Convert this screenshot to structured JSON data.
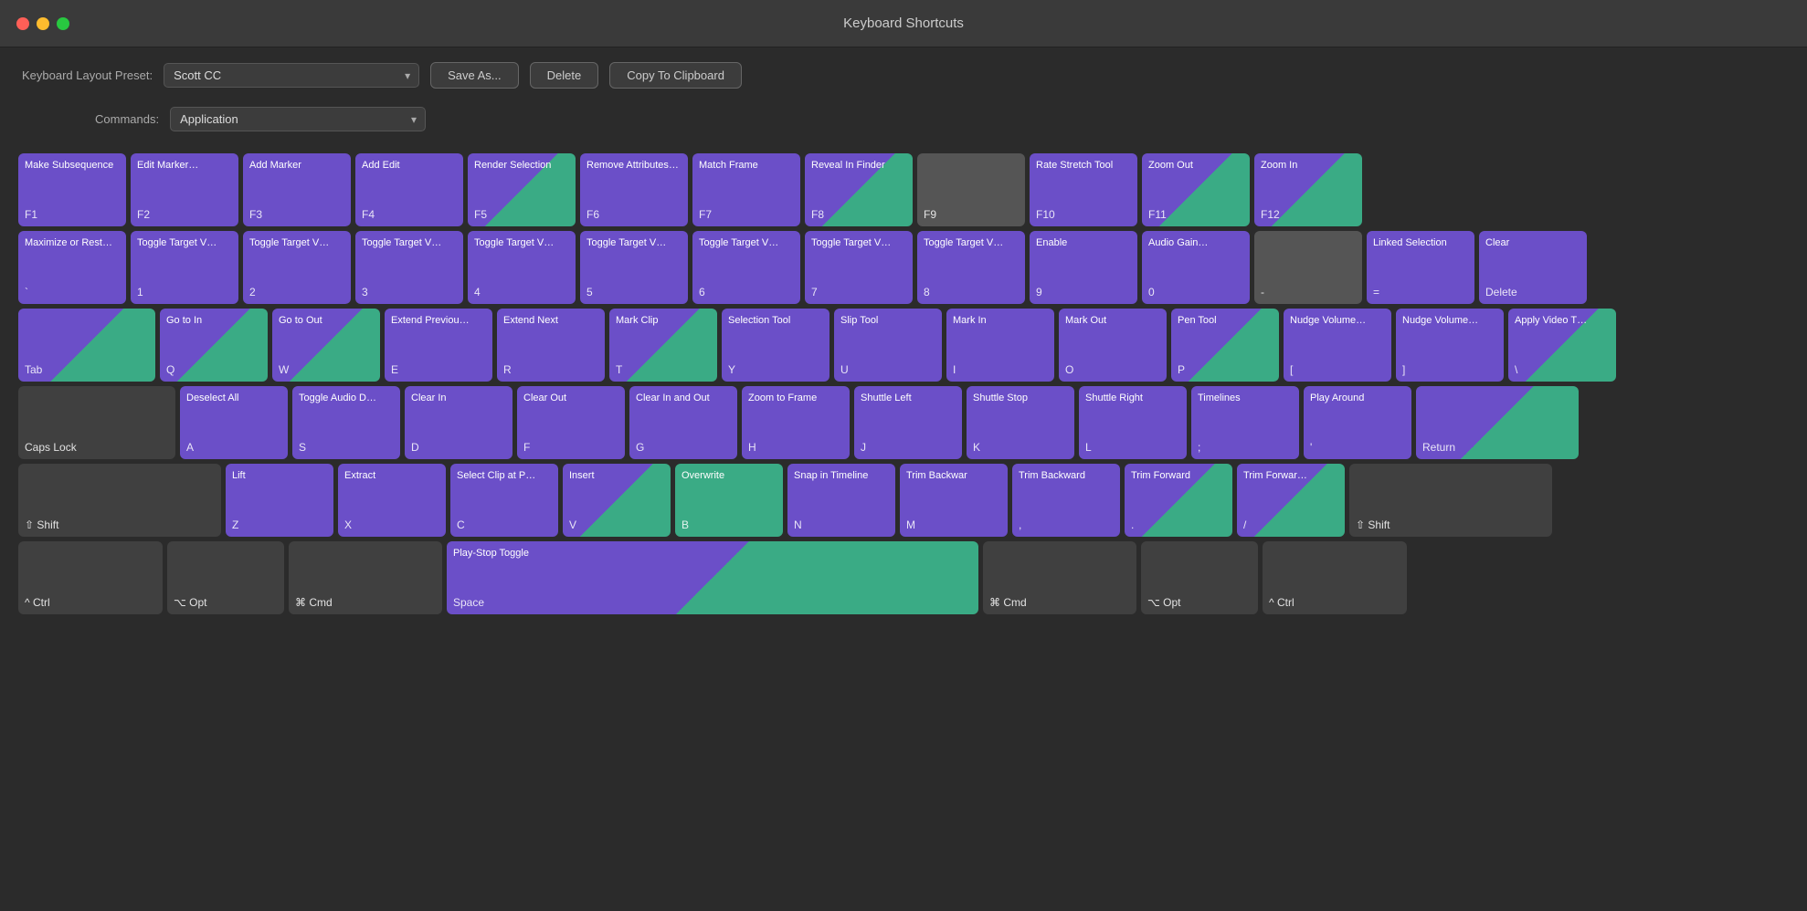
{
  "titleBar": {
    "title": "Keyboard Shortcuts"
  },
  "toolbar": {
    "presetLabel": "Keyboard Layout Preset:",
    "presetValue": "Scott CC",
    "commandsLabel": "Commands:",
    "commandsValue": "Application",
    "saveAsLabel": "Save As...",
    "deleteLabel": "Delete",
    "copyToClipboardLabel": "Copy To Clipboard"
  },
  "rows": [
    {
      "id": "row-fn",
      "keys": [
        {
          "id": "f1",
          "name": "Make Subsequence",
          "shortcut": "F1",
          "style": "purple"
        },
        {
          "id": "f2",
          "name": "Edit Marker…",
          "shortcut": "F2",
          "style": "purple"
        },
        {
          "id": "f3",
          "name": "Add Marker",
          "shortcut": "F3",
          "style": "purple"
        },
        {
          "id": "f4",
          "name": "Add Edit",
          "shortcut": "F4",
          "style": "purple"
        },
        {
          "id": "f5",
          "name": "Render Selection",
          "shortcut": "F5",
          "style": "split"
        },
        {
          "id": "f6",
          "name": "Remove Attributes…",
          "shortcut": "F6",
          "style": "purple"
        },
        {
          "id": "f7",
          "name": "Match Frame",
          "shortcut": "F7",
          "style": "purple"
        },
        {
          "id": "f8",
          "name": "Reveal In Finder",
          "shortcut": "F8",
          "style": "split"
        },
        {
          "id": "f9",
          "name": "",
          "shortcut": "F9",
          "style": "gray"
        },
        {
          "id": "f10",
          "name": "Rate Stretch Tool",
          "shortcut": "F10",
          "style": "purple"
        },
        {
          "id": "f11",
          "name": "Zoom Out",
          "shortcut": "F11",
          "style": "split"
        },
        {
          "id": "f12",
          "name": "Zoom In",
          "shortcut": "F12",
          "style": "split"
        }
      ]
    },
    {
      "id": "row-numbers",
      "keys": [
        {
          "id": "backtick",
          "name": "Maximize or Rest…",
          "shortcut": "`",
          "style": "purple"
        },
        {
          "id": "1",
          "name": "Toggle Target V…",
          "shortcut": "1",
          "style": "purple"
        },
        {
          "id": "2",
          "name": "Toggle Target V…",
          "shortcut": "2",
          "style": "purple"
        },
        {
          "id": "3",
          "name": "Toggle Target V…",
          "shortcut": "3",
          "style": "purple"
        },
        {
          "id": "4",
          "name": "Toggle Target V…",
          "shortcut": "4",
          "style": "purple"
        },
        {
          "id": "5",
          "name": "Toggle Target V…",
          "shortcut": "5",
          "style": "purple"
        },
        {
          "id": "6",
          "name": "Toggle Target V…",
          "shortcut": "6",
          "style": "purple"
        },
        {
          "id": "7",
          "name": "Toggle Target V…",
          "shortcut": "7",
          "style": "purple"
        },
        {
          "id": "8",
          "name": "Toggle Target V…",
          "shortcut": "8",
          "style": "purple"
        },
        {
          "id": "9",
          "name": "Enable",
          "shortcut": "9",
          "style": "purple"
        },
        {
          "id": "0",
          "name": "Audio Gain…",
          "shortcut": "0",
          "style": "purple"
        },
        {
          "id": "minus",
          "name": "",
          "shortcut": "-",
          "style": "gray"
        },
        {
          "id": "equals",
          "name": "Linked Selection",
          "shortcut": "=",
          "style": "purple"
        },
        {
          "id": "delete",
          "name": "Clear",
          "shortcut": "Delete",
          "style": "purple"
        }
      ]
    },
    {
      "id": "row-qwerty",
      "keys": [
        {
          "id": "tab",
          "name": "",
          "shortcut": "Tab",
          "style": "split",
          "wide": "tab"
        },
        {
          "id": "q",
          "name": "Go to In",
          "shortcut": "Q",
          "style": "split"
        },
        {
          "id": "w",
          "name": "Go to Out",
          "shortcut": "W",
          "style": "split"
        },
        {
          "id": "e",
          "name": "Extend Previou…",
          "shortcut": "E",
          "style": "purple"
        },
        {
          "id": "r",
          "name": "Extend Next",
          "shortcut": "R",
          "style": "purple"
        },
        {
          "id": "t",
          "name": "Mark Clip",
          "shortcut": "T",
          "style": "split"
        },
        {
          "id": "y",
          "name": "Selection Tool",
          "shortcut": "Y",
          "style": "purple"
        },
        {
          "id": "u",
          "name": "Slip Tool",
          "shortcut": "U",
          "style": "purple"
        },
        {
          "id": "i",
          "name": "Mark In",
          "shortcut": "I",
          "style": "purple"
        },
        {
          "id": "o",
          "name": "Mark Out",
          "shortcut": "O",
          "style": "purple"
        },
        {
          "id": "p",
          "name": "Pen Tool",
          "shortcut": "P",
          "style": "split"
        },
        {
          "id": "bracket-l",
          "name": "Nudge Volume…",
          "shortcut": "[",
          "style": "purple"
        },
        {
          "id": "bracket-r",
          "name": "Nudge Volume…",
          "shortcut": "]",
          "style": "purple"
        },
        {
          "id": "backslash",
          "name": "Apply Video T…",
          "shortcut": "\\",
          "style": "split"
        }
      ]
    },
    {
      "id": "row-asdf",
      "keys": [
        {
          "id": "caps",
          "name": "",
          "shortcut": "Caps Lock",
          "style": "modifier",
          "wide": "caps"
        },
        {
          "id": "a",
          "name": "Deselect All",
          "shortcut": "A",
          "style": "purple"
        },
        {
          "id": "s",
          "name": "Toggle Audio D…",
          "shortcut": "S",
          "style": "purple"
        },
        {
          "id": "d",
          "name": "Clear In",
          "shortcut": "D",
          "style": "purple"
        },
        {
          "id": "f",
          "name": "Clear Out",
          "shortcut": "F",
          "style": "purple"
        },
        {
          "id": "g",
          "name": "Clear In and Out",
          "shortcut": "G",
          "style": "purple"
        },
        {
          "id": "h",
          "name": "Zoom to Frame",
          "shortcut": "H",
          "style": "purple"
        },
        {
          "id": "j",
          "name": "Shuttle Left",
          "shortcut": "J",
          "style": "purple"
        },
        {
          "id": "k",
          "name": "Shuttle Stop",
          "shortcut": "K",
          "style": "purple"
        },
        {
          "id": "l",
          "name": "Shuttle Right",
          "shortcut": "L",
          "style": "purple"
        },
        {
          "id": "semicolon",
          "name": "Timelines",
          "shortcut": ";",
          "style": "purple"
        },
        {
          "id": "quote",
          "name": "Play Around",
          "shortcut": "'",
          "style": "purple"
        },
        {
          "id": "return",
          "name": "",
          "shortcut": "Return",
          "style": "split",
          "wide": "return"
        }
      ]
    },
    {
      "id": "row-zxcv",
      "keys": [
        {
          "id": "shift-l",
          "name": "",
          "shortcut": "⇧ Shift",
          "style": "modifier",
          "wide": "shift-l"
        },
        {
          "id": "z",
          "name": "Lift",
          "shortcut": "Z",
          "style": "purple"
        },
        {
          "id": "x",
          "name": "Extract",
          "shortcut": "X",
          "style": "purple"
        },
        {
          "id": "c",
          "name": "Select Clip at P…",
          "shortcut": "C",
          "style": "purple"
        },
        {
          "id": "v",
          "name": "Insert",
          "shortcut": "V",
          "style": "split"
        },
        {
          "id": "b",
          "name": "Overwrite",
          "shortcut": "B",
          "style": "green"
        },
        {
          "id": "n",
          "name": "Snap in Timeline",
          "shortcut": "N",
          "style": "purple"
        },
        {
          "id": "m",
          "name": "Trim Backwar",
          "shortcut": "M",
          "style": "purple"
        },
        {
          "id": "comma",
          "name": "Trim Backward",
          "shortcut": ",",
          "style": "purple"
        },
        {
          "id": "period",
          "name": "Trim Forward",
          "shortcut": ".",
          "style": "split"
        },
        {
          "id": "slash",
          "name": "Trim Forwar…",
          "shortcut": "/",
          "style": "split"
        },
        {
          "id": "shift-r",
          "name": "",
          "shortcut": "⇧ Shift",
          "style": "modifier",
          "wide": "shift-r"
        }
      ]
    },
    {
      "id": "row-bottom",
      "keys": [
        {
          "id": "ctrl-l",
          "name": "",
          "shortcut": "^ Ctrl",
          "style": "modifier",
          "wide": "ctrl"
        },
        {
          "id": "opt-l",
          "name": "",
          "shortcut": "⌥ Opt",
          "style": "modifier",
          "wide": "opt"
        },
        {
          "id": "cmd-l",
          "name": "",
          "shortcut": "⌘ Cmd",
          "style": "modifier",
          "wide": "cmd"
        },
        {
          "id": "space",
          "name": "Play-Stop Toggle",
          "shortcut": "Space",
          "style": "split",
          "wide": "space"
        },
        {
          "id": "cmd-r",
          "name": "",
          "shortcut": "⌘ Cmd",
          "style": "modifier",
          "wide": "cmd"
        },
        {
          "id": "opt-r",
          "name": "",
          "shortcut": "⌥ Opt",
          "style": "modifier",
          "wide": "opt"
        },
        {
          "id": "ctrl-r",
          "name": "",
          "shortcut": "^ Ctrl",
          "style": "modifier",
          "wide": "ctrl"
        }
      ]
    }
  ]
}
